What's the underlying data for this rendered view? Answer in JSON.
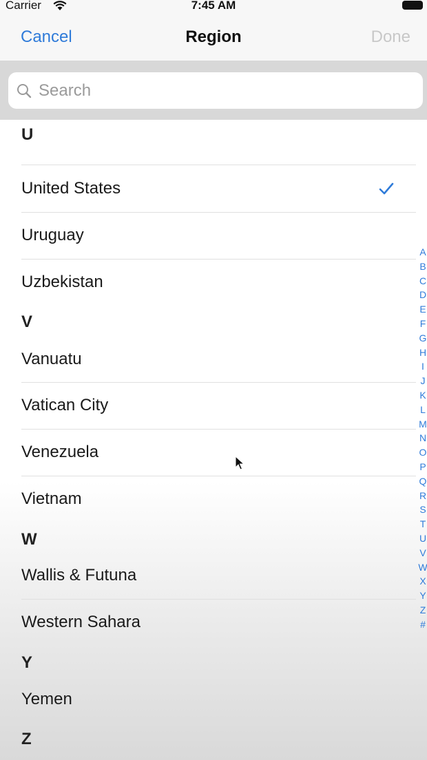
{
  "status_bar": {
    "carrier": "Carrier",
    "time": "7:45 AM",
    "icons": [
      "wifi-icon",
      "battery-icon"
    ]
  },
  "nav": {
    "cancel_label": "Cancel",
    "title": "Region",
    "done_label": "Done"
  },
  "search": {
    "placeholder": "Search"
  },
  "list": {
    "sections": [
      {
        "header": "U",
        "items": [
          {
            "label": "United States",
            "selected": true
          },
          {
            "label": "Uruguay"
          },
          {
            "label": "Uzbekistan"
          }
        ]
      },
      {
        "header": "V",
        "items": [
          {
            "label": "Vanuatu"
          },
          {
            "label": "Vatican City"
          },
          {
            "label": "Venezuela"
          },
          {
            "label": "Vietnam"
          }
        ]
      },
      {
        "header": "W",
        "items": [
          {
            "label": "Wallis & Futuna"
          },
          {
            "label": "Western Sahara"
          }
        ]
      },
      {
        "header": "Y",
        "items": [
          {
            "label": "Yemen"
          }
        ]
      },
      {
        "header": "Z",
        "items": []
      }
    ]
  },
  "section_index": [
    "A",
    "B",
    "C",
    "D",
    "E",
    "F",
    "G",
    "H",
    "I",
    "J",
    "K",
    "L",
    "M",
    "N",
    "O",
    "P",
    "Q",
    "R",
    "S",
    "T",
    "U",
    "V",
    "W",
    "X",
    "Y",
    "Z",
    "#"
  ],
  "colors": {
    "accent": "#2f7bd9",
    "disabled": "#c8c8c8",
    "bar_background": "#f7f7f7",
    "search_background": "#d8d8d8"
  }
}
